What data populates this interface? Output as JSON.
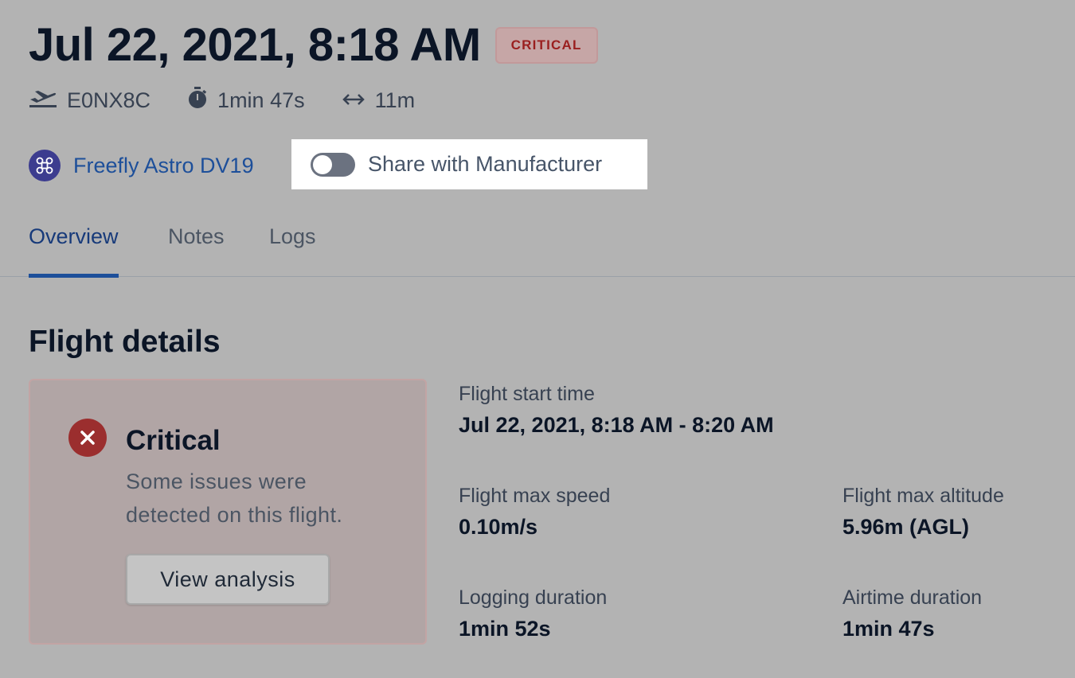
{
  "header": {
    "title": "Jul 22, 2021, 8:18 AM",
    "status_badge": "CRITICAL",
    "meta": {
      "flight_id": "E0NX8C",
      "duration": "1min 47s",
      "distance": "11m"
    },
    "aircraft_name": "Freefly Astro DV19",
    "share_toggle": {
      "label": "Share with Manufacturer",
      "enabled": false
    }
  },
  "tabs": [
    {
      "label": "Overview",
      "active": true
    },
    {
      "label": "Notes",
      "active": false
    },
    {
      "label": "Logs",
      "active": false
    }
  ],
  "flight_details": {
    "section_title": "Flight details",
    "alert": {
      "title": "Critical",
      "description": "Some issues were detected on this flight.",
      "button_label": "View analysis"
    },
    "start_time": {
      "label": "Flight start time",
      "value": "Jul 22, 2021, 8:18 AM - 8:20 AM"
    },
    "max_speed": {
      "label": "Flight max speed",
      "value": "0.10m/s"
    },
    "max_altitude": {
      "label": "Flight max altitude",
      "value": "5.96m (AGL)"
    },
    "logging_duration": {
      "label": "Logging duration",
      "value": "1min 52s"
    },
    "airtime_duration": {
      "label": "Airtime duration",
      "value": "1min 47s"
    }
  },
  "colors": {
    "accent": "#1d4f9a",
    "critical": "#9b2e2e",
    "background": "#b3b3b3"
  },
  "icons": [
    "plane-takeoff-icon",
    "stopwatch-icon",
    "distance-arrow-icon",
    "drone-icon",
    "close-icon"
  ]
}
